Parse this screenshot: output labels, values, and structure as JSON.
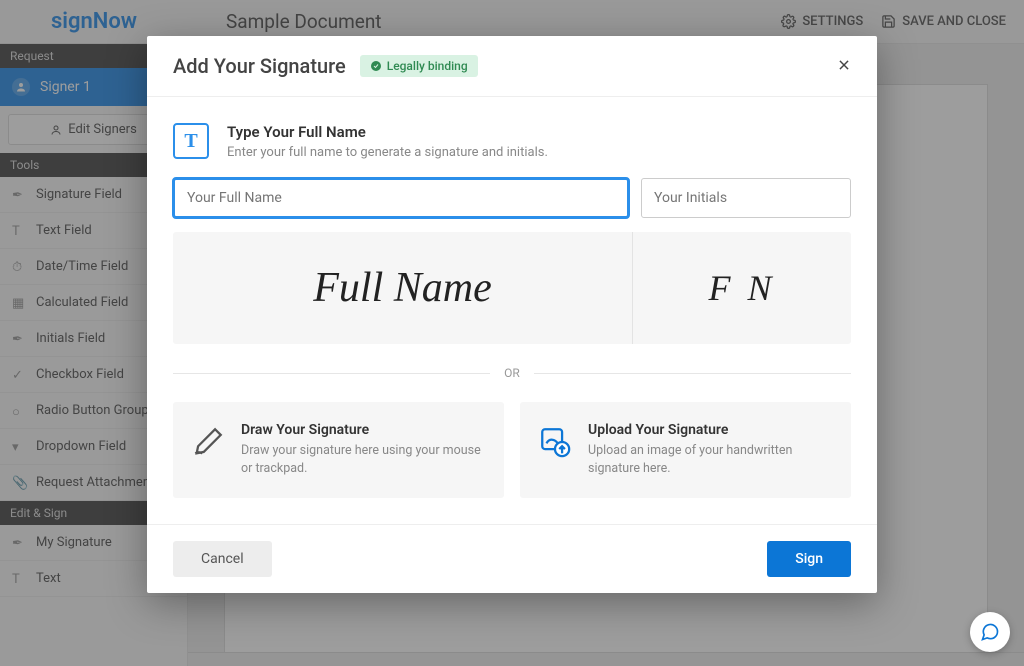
{
  "header": {
    "logo": "signNow",
    "doc_title": "Sample Document",
    "settings": "SETTINGS",
    "save_close": "SAVE AND CLOSE"
  },
  "sidebar": {
    "request_header": "Request",
    "signer": "Signer 1",
    "edit_signers": "Edit Signers",
    "tools_header": "Tools",
    "tools": [
      "Signature Field",
      "Text Field",
      "Date/Time Field",
      "Calculated Field",
      "Initials Field",
      "Checkbox Field",
      "Radio Button Group",
      "Dropdown Field",
      "Request Attachment"
    ],
    "editsign_header": "Edit & Sign",
    "editsign": [
      "My Signature",
      "Text"
    ]
  },
  "modal": {
    "title": "Add Your Signature",
    "badge": "Legally binding",
    "type_title": "Type Your Full Name",
    "type_sub": "Enter your full name to generate a signature and initials.",
    "name_ph": "Your Full Name",
    "init_ph": "Your Initials",
    "preview_name": "Full Name",
    "preview_init": "F N",
    "or": "OR",
    "draw_title": "Draw Your Signature",
    "draw_sub": "Draw your signature here using your mouse or trackpad.",
    "upload_title": "Upload Your Signature",
    "upload_sub": "Upload an image of your handwritten signature here.",
    "cancel": "Cancel",
    "sign": "Sign"
  }
}
